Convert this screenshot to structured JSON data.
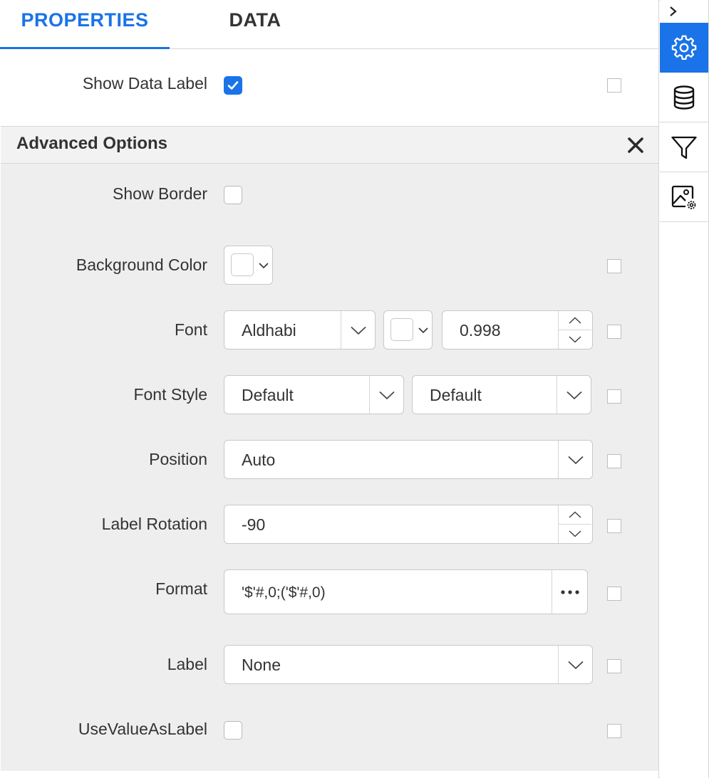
{
  "tabs": [
    {
      "label": "PROPERTIES",
      "active": true
    },
    {
      "label": "DATA",
      "active": false
    }
  ],
  "show_data_label": {
    "label": "Show Data Label",
    "checked": true
  },
  "advanced": {
    "title": "Advanced Options",
    "show_border": {
      "label": "Show Border",
      "checked": false
    },
    "background_color": {
      "label": "Background Color",
      "color": "#ffffff"
    },
    "font": {
      "label": "Font",
      "family": "Aldhabi",
      "color": "#ffffff",
      "size": "0.998"
    },
    "font_style": {
      "label": "Font Style",
      "style": "Default",
      "weight": "Default"
    },
    "position": {
      "label": "Position",
      "value": "Auto"
    },
    "label_rotation": {
      "label": "Label Rotation",
      "value": "-90"
    },
    "format": {
      "label": "Format",
      "value": "'$'#,0;('$'#,0)"
    },
    "label": {
      "label": "Label",
      "value": "None"
    },
    "use_value_as_label": {
      "label": "UseValueAsLabel",
      "checked": false
    }
  },
  "rail": {
    "items": [
      {
        "icon": "gear-icon",
        "active": true
      },
      {
        "icon": "database-icon",
        "active": false
      },
      {
        "icon": "filter-icon",
        "active": false
      },
      {
        "icon": "image-settings-icon",
        "active": false
      }
    ]
  },
  "colors": {
    "accent": "#1a73e8",
    "section_bg": "#eeeeee",
    "border": "#d6d6d6"
  }
}
